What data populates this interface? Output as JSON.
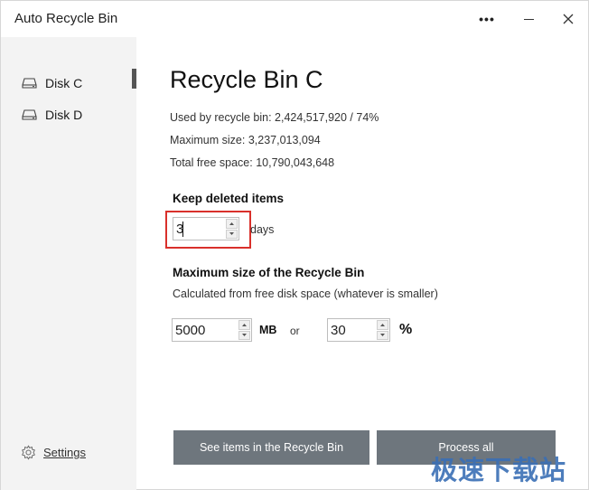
{
  "window": {
    "title": "Auto Recycle Bin"
  },
  "titlebar": {
    "more_icon": "more-dots-icon",
    "min_icon": "minimize-icon",
    "close_icon": "close-icon",
    "more_glyph": "•••",
    "close_glyph": "✕"
  },
  "sidebar": {
    "items": [
      {
        "label": "Disk C",
        "icon": "disk-drive-icon",
        "active": true
      },
      {
        "label": "Disk D",
        "icon": "disk-drive-icon",
        "active": false
      }
    ],
    "settings_label": "Settings"
  },
  "main": {
    "title": "Recycle Bin C",
    "used": "Used by recycle bin: 2,424,517,920 / 74%",
    "max": "Maximum size: 3,237,013,094",
    "free": "Total free space: 10,790,043,648",
    "keep": {
      "title": "Keep deleted items",
      "value": "3",
      "unit": "days"
    },
    "size": {
      "title": "Maximum size of the Recycle Bin",
      "subtitle": "Calculated from free disk space (whatever is smaller)",
      "mb_value": "5000",
      "mb_unit": "MB",
      "or_label": "or",
      "pct_value": "30",
      "pct_unit": "%"
    },
    "buttons": {
      "see_items": "See items in the Recycle Bin",
      "process_all": "Process all"
    }
  },
  "watermark": "极速下载站",
  "colors": {
    "highlight": "#d9302b",
    "button": "#6e767d",
    "sidebar": "#f3f3f3",
    "watermark": "#3a6fb5"
  }
}
